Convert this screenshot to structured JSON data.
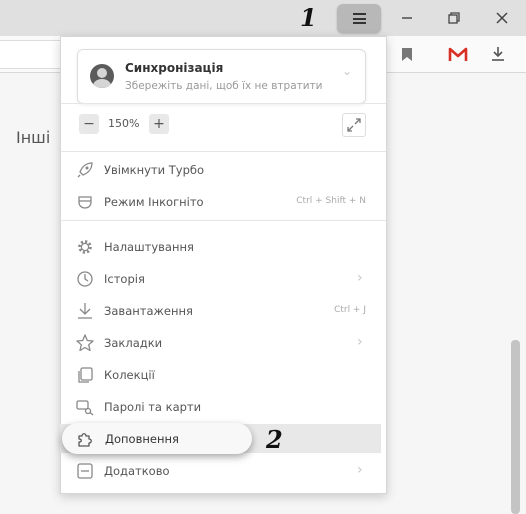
{
  "annotations": {
    "step1": "1",
    "step2": "2"
  },
  "content": {
    "side_label": "Інші"
  },
  "sync": {
    "title": "Синхронізація",
    "subtitle": "Збережіть дані, щоб їх не втратити",
    "chevron": "⌄"
  },
  "zoom": {
    "minus": "−",
    "value": "150%",
    "plus": "+"
  },
  "menu_items": [
    {
      "label": "Увімкнути Турбо",
      "icon": "rocket-icon",
      "shortcut": "",
      "submenu": false
    },
    {
      "label": "Режим Інкогніто",
      "icon": "incognito-mask-icon",
      "shortcut": "Ctrl + Shift + N",
      "submenu": false
    },
    {
      "label": "Налаштування",
      "icon": "gear-icon",
      "shortcut": "",
      "submenu": false
    },
    {
      "label": "Історія",
      "icon": "clock-icon",
      "shortcut": "",
      "submenu": true,
      "chevron": "›"
    },
    {
      "label": "Завантаження",
      "icon": "download-icon",
      "shortcut": "Ctrl + J",
      "submenu": false
    },
    {
      "label": "Закладки",
      "icon": "star-icon",
      "shortcut": "",
      "submenu": true,
      "chevron": "›"
    },
    {
      "label": "Колекції",
      "icon": "collections-icon",
      "shortcut": "",
      "submenu": false
    },
    {
      "label": "Паролі та карти",
      "icon": "key-card-icon",
      "shortcut": "",
      "submenu": false
    },
    {
      "label": "Доповнення",
      "icon": "puzzle-icon",
      "shortcut": "",
      "submenu": false
    },
    {
      "label": "Додатково",
      "icon": "more-icon",
      "shortcut": "",
      "submenu": true,
      "chevron": "›"
    }
  ],
  "colors": {
    "gmail_red": "#d93025",
    "menu_button_highlight": "#b8b8b8"
  }
}
